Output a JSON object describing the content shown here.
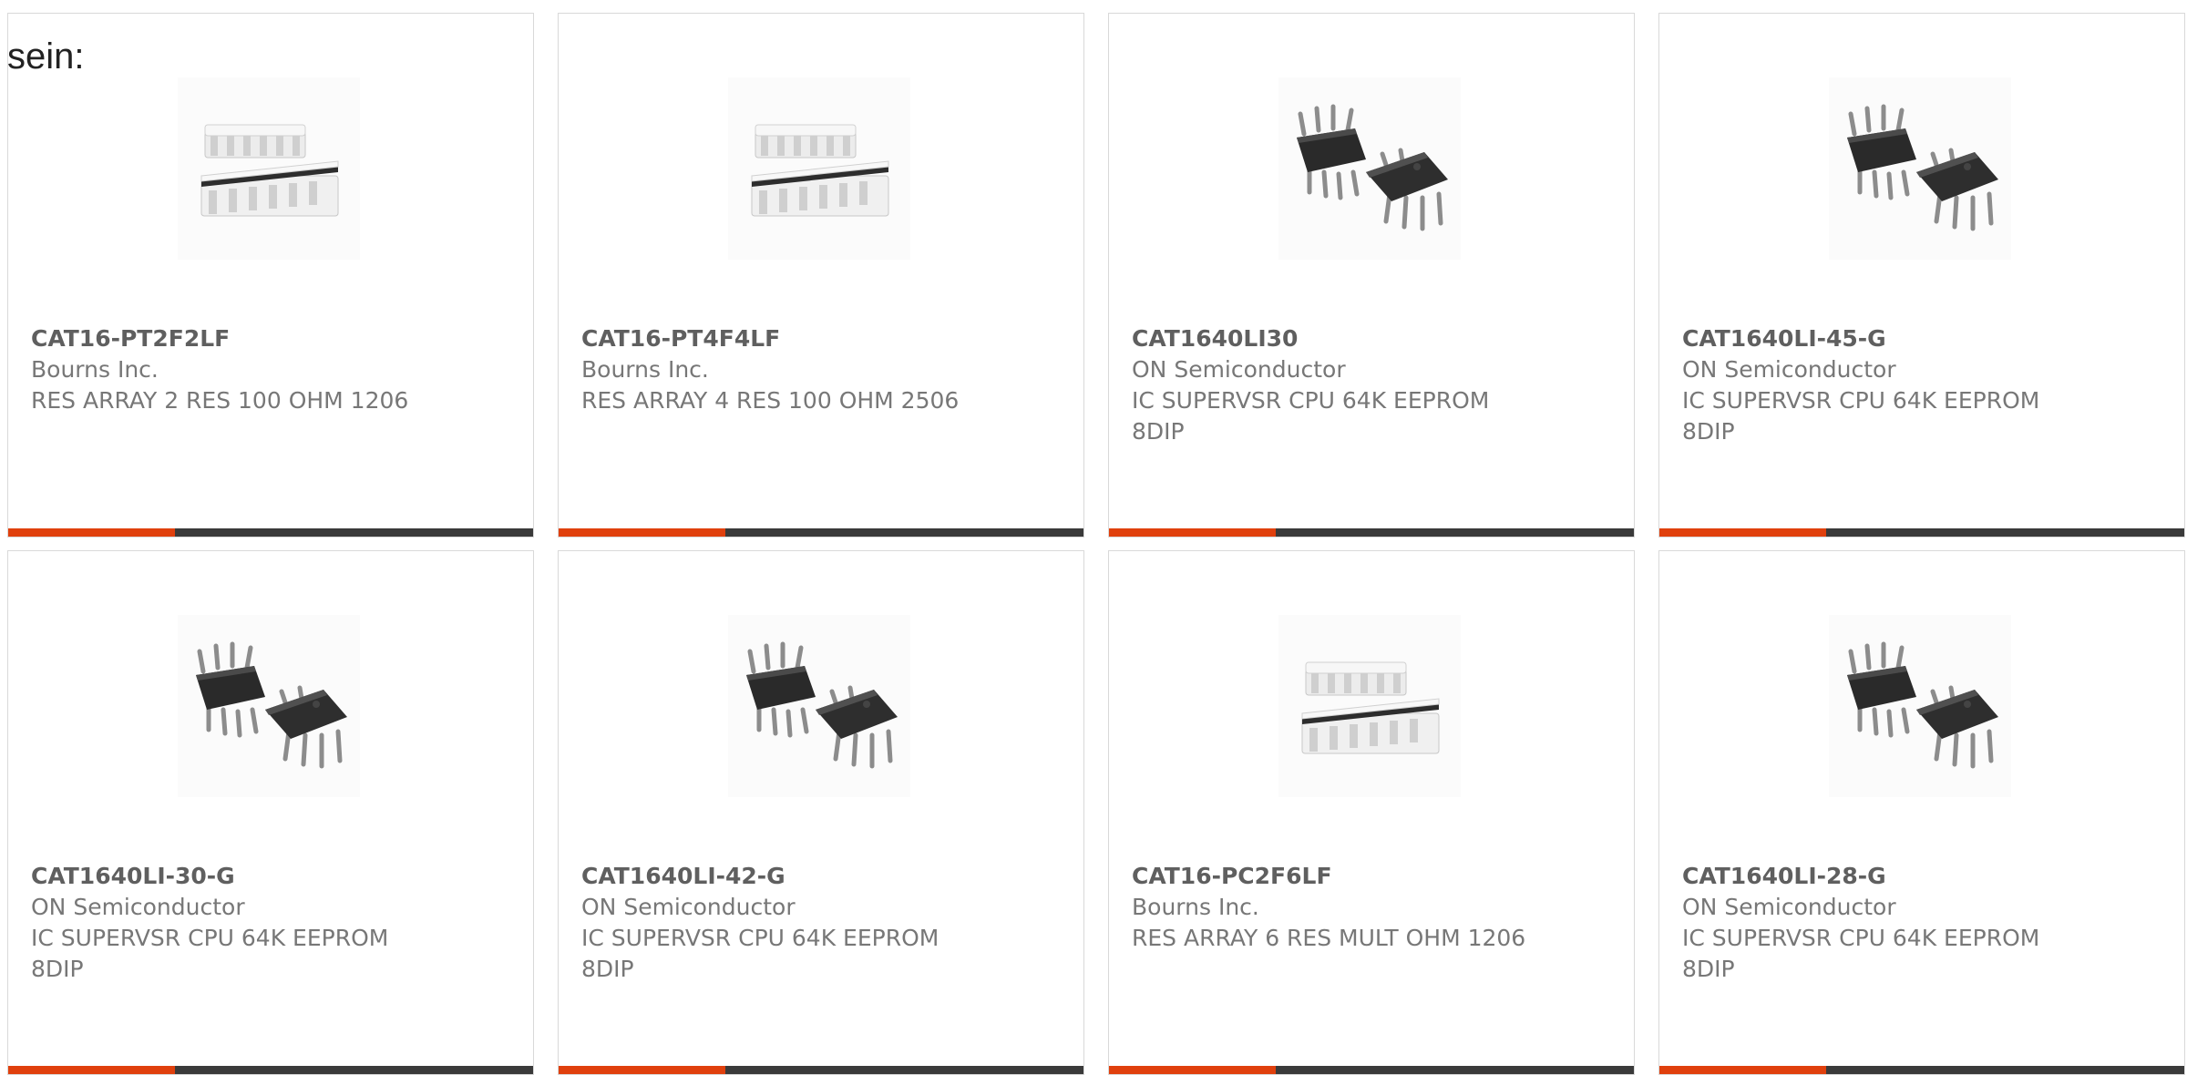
{
  "intro_text": "sein:",
  "colors": {
    "accent": "#e0400d",
    "bar": "#3a3a3a",
    "card_border": "#d9d9d9",
    "text_muted": "#777777",
    "text_title": "#5f5f5f"
  },
  "products": [
    {
      "part_number": "CAT16-PT2F2LF",
      "manufacturer": "Bourns Inc.",
      "description": "RES ARRAY 2 RES 100 OHM 1206",
      "image": "resistor-array-icon"
    },
    {
      "part_number": "CAT16-PT4F4LF",
      "manufacturer": "Bourns Inc.",
      "description": "RES ARRAY 4 RES 100 OHM 2506",
      "image": "resistor-array-icon"
    },
    {
      "part_number": "CAT1640LI30",
      "manufacturer": "ON Semiconductor",
      "description": "IC SUPERVSR CPU 64K EEPROM 8DIP",
      "image": "dip-ic-icon"
    },
    {
      "part_number": "CAT1640LI-45-G",
      "manufacturer": "ON Semiconductor",
      "description": "IC SUPERVSR CPU 64K EEPROM 8DIP",
      "image": "dip-ic-icon"
    },
    {
      "part_number": "CAT1640LI-30-G",
      "manufacturer": "ON Semiconductor",
      "description": "IC SUPERVSR CPU 64K EEPROM 8DIP",
      "image": "dip-ic-icon"
    },
    {
      "part_number": "CAT1640LI-42-G",
      "manufacturer": "ON Semiconductor",
      "description": "IC SUPERVSR CPU 64K EEPROM 8DIP",
      "image": "dip-ic-icon"
    },
    {
      "part_number": "CAT16-PC2F6LF",
      "manufacturer": "Bourns Inc.",
      "description": "RES ARRAY 6 RES MULT OHM 1206",
      "image": "resistor-array-icon"
    },
    {
      "part_number": "CAT1640LI-28-G",
      "manufacturer": "ON Semiconductor",
      "description": "IC SUPERVSR CPU 64K EEPROM 8DIP",
      "image": "dip-ic-icon"
    }
  ]
}
